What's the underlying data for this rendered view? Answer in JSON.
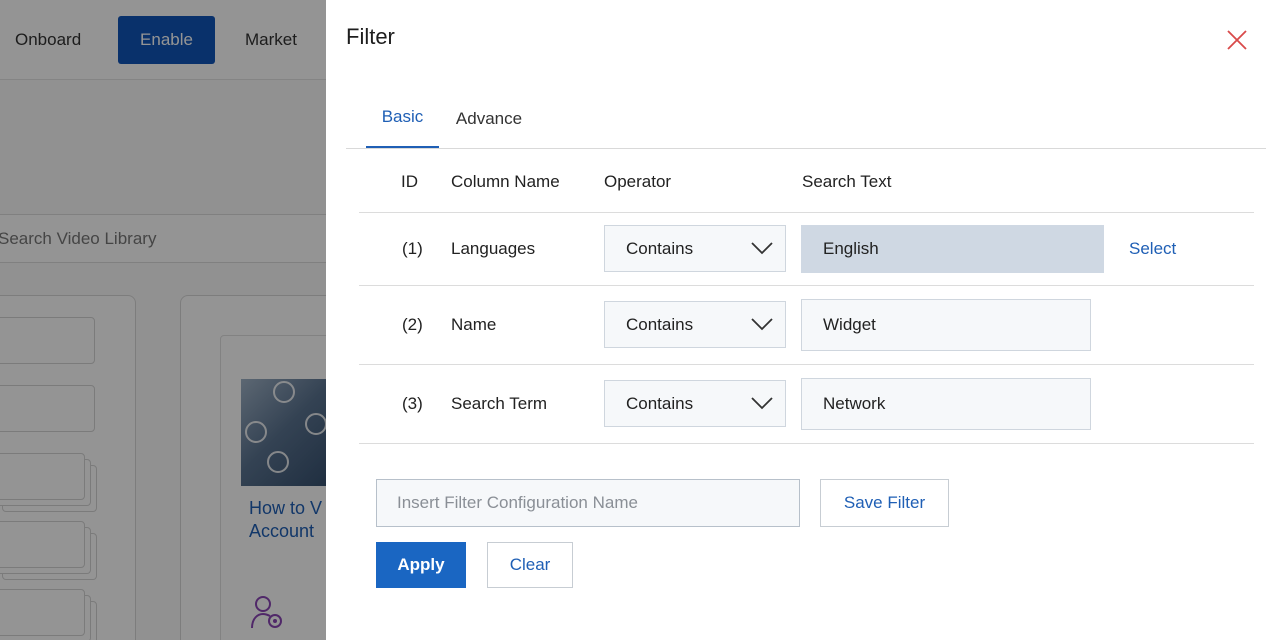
{
  "background": {
    "nav": {
      "onboard": "Onboard",
      "enable": "Enable",
      "market": "Market"
    },
    "search_placeholder": "Search Video Library",
    "card_title_line1": "How to V",
    "card_title_line2": "Account"
  },
  "drawer": {
    "title": "Filter",
    "close_icon": "close-icon",
    "tabs": {
      "basic": "Basic",
      "advance": "Advance"
    },
    "active_tab": "Basic",
    "columns": {
      "id": "ID",
      "column_name": "Column Name",
      "operator": "Operator",
      "search_text": "Search Text"
    },
    "rows": [
      {
        "id": "(1)",
        "column": "Languages",
        "operator": "Contains",
        "search_text": "English",
        "action": "Select"
      },
      {
        "id": "(2)",
        "column": "Name",
        "operator": "Contains",
        "search_text": "Widget"
      },
      {
        "id": "(3)",
        "column": "Search Term",
        "operator": "Contains",
        "search_text": "Network"
      }
    ],
    "config_placeholder": "Insert Filter Configuration Name",
    "config_value": "",
    "buttons": {
      "save_filter": "Save Filter",
      "apply": "Apply",
      "clear": "Clear"
    }
  },
  "colors": {
    "accent": "#1f5fb5",
    "primary_button": "#1a66c2",
    "close_icon": "#d94a4a",
    "overlay": "rgba(0,0,0,0.42)"
  }
}
